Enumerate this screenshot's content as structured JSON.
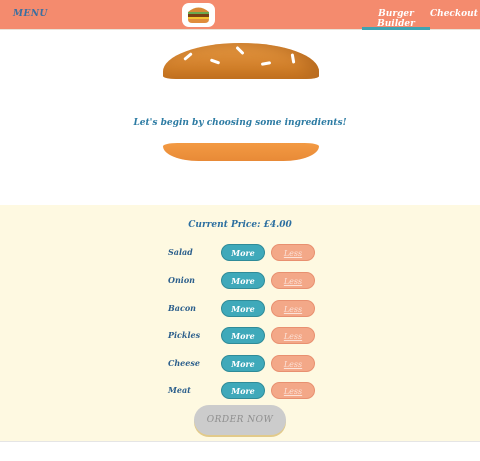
{
  "toolbar": {
    "menu_label": "MENU",
    "logo_icon": "burger-logo-icon",
    "nav": [
      {
        "label": "Burger Builder",
        "active": true
      },
      {
        "label": "Checkout",
        "active": false
      }
    ]
  },
  "burger": {
    "message": "Let's begin by choosing some ingredients!"
  },
  "controls": {
    "price_label": "Current Price: £4.00",
    "more_label": "More",
    "less_label": "Less",
    "ingredients": [
      "Salad",
      "Onion",
      "Bacon",
      "Pickles",
      "Cheese",
      "Meat"
    ],
    "order_label": "ORDER NOW"
  },
  "colors": {
    "toolbar": "#f48b6e",
    "more": "#3fa9ba",
    "less": "#f3a888",
    "controls_bg": "#fef9e1"
  }
}
